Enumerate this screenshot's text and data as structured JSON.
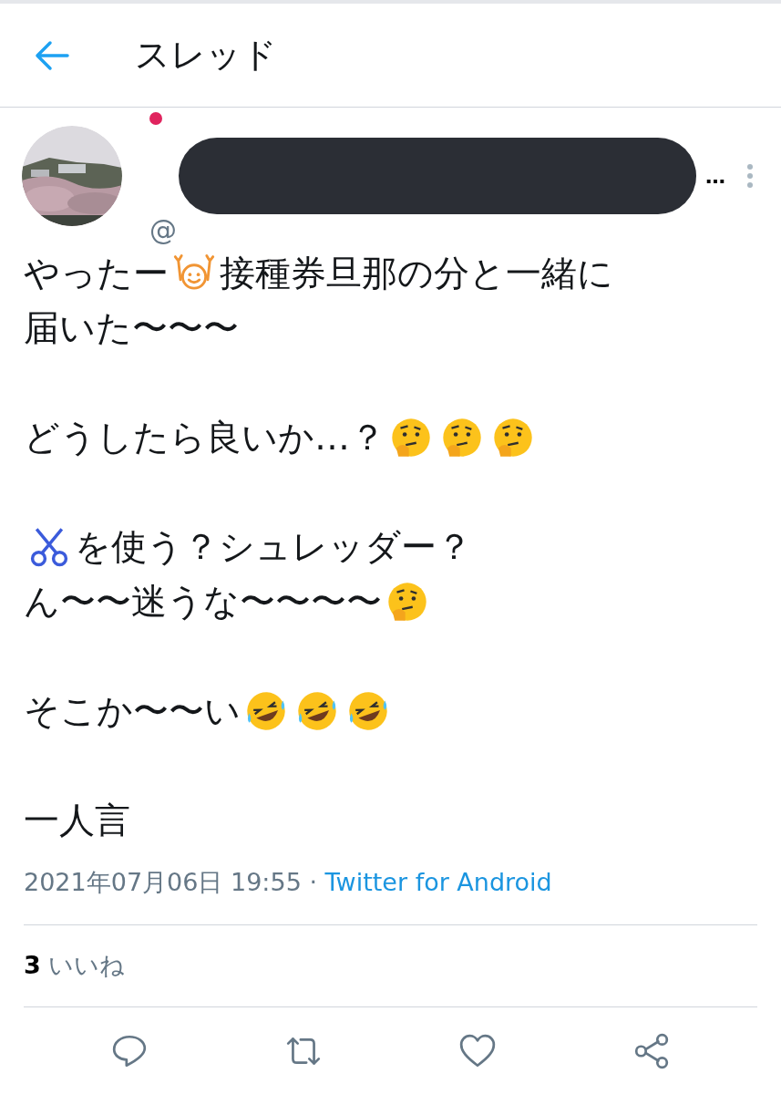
{
  "header": {
    "title": "スレッド"
  },
  "author": {
    "handle_prefix": "@",
    "name_tail": "…"
  },
  "body": [
    {
      "lines": [
        [
          {
            "kind": "text",
            "text": "やったー"
          },
          {
            "kind": "cheer"
          },
          {
            "kind": "text",
            "text": "接種券旦那の分と一緒に"
          }
        ],
        [
          {
            "kind": "text",
            "text": "届いた〜〜〜"
          }
        ]
      ]
    },
    {
      "lines": [
        [
          {
            "kind": "text",
            "text": "どうしたら良いか…？"
          },
          {
            "kind": "think"
          },
          {
            "kind": "think"
          },
          {
            "kind": "think"
          }
        ]
      ]
    },
    {
      "lines": [
        [
          {
            "kind": "scissors"
          },
          {
            "kind": "text",
            "text": "を使う？シュレッダー？"
          }
        ],
        [
          {
            "kind": "text",
            "text": "ん〜〜迷うな〜〜〜〜"
          },
          {
            "kind": "think"
          }
        ]
      ]
    },
    {
      "lines": [
        [
          {
            "kind": "text",
            "text": "そこか〜〜い"
          },
          {
            "kind": "laugh"
          },
          {
            "kind": "laugh"
          },
          {
            "kind": "laugh"
          }
        ]
      ]
    },
    {
      "lines": [
        [
          {
            "kind": "text",
            "text": "一人言"
          }
        ]
      ]
    }
  ],
  "timestamp": "2021年07月06日 19:55 · ",
  "source": "Twitter for Android",
  "likes": {
    "count": "3",
    "label": "いいね"
  },
  "actions": [
    {
      "kind": "reply"
    },
    {
      "kind": "retweet"
    },
    {
      "kind": "like"
    },
    {
      "kind": "share"
    }
  ]
}
